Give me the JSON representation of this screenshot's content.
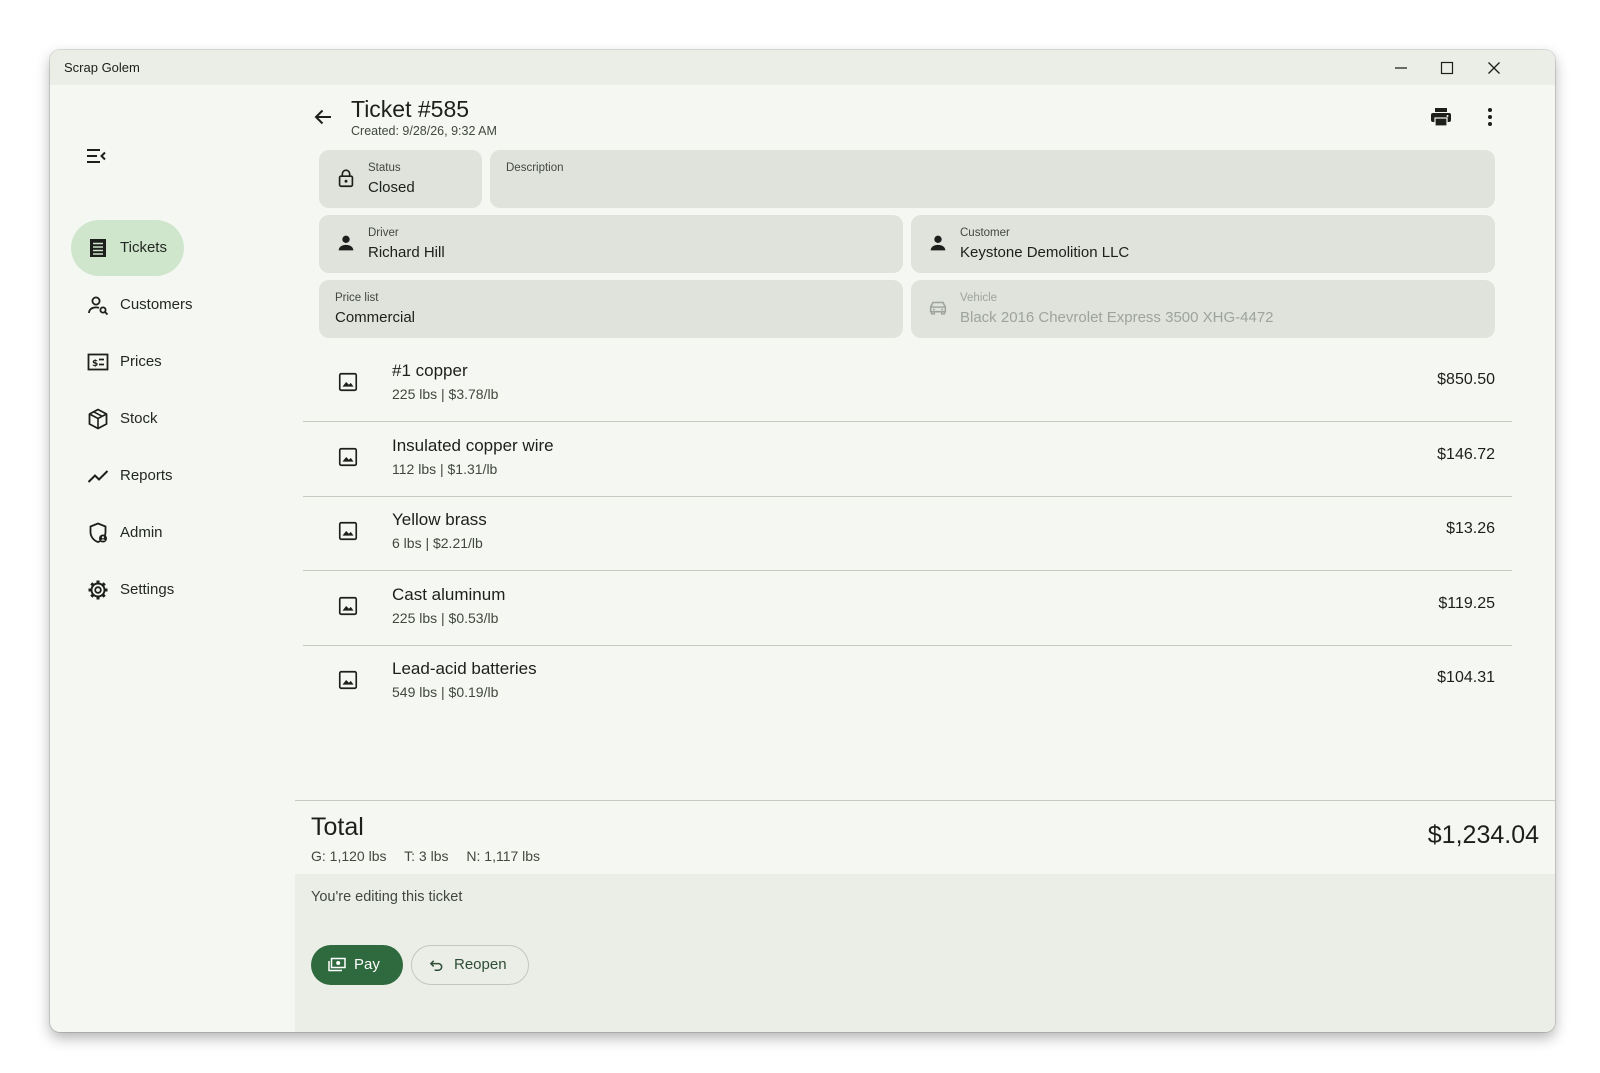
{
  "window": {
    "title": "Scrap Golem"
  },
  "sidebar": {
    "items": [
      {
        "label": "Tickets",
        "icon": "receipt-icon",
        "active": true
      },
      {
        "label": "Customers",
        "icon": "person-search-icon"
      },
      {
        "label": "Prices",
        "icon": "price-card-icon"
      },
      {
        "label": "Stock",
        "icon": "package-icon"
      },
      {
        "label": "Reports",
        "icon": "trending-line-icon"
      },
      {
        "label": "Admin",
        "icon": "admin-shield-icon"
      },
      {
        "label": "Settings",
        "icon": "gear-icon"
      }
    ]
  },
  "header": {
    "title": "Ticket #585",
    "created": "Created: 9/28/26, 9:32 AM"
  },
  "fields": {
    "status": {
      "label": "Status",
      "value": "Closed"
    },
    "description": {
      "label": "Description",
      "value": ""
    },
    "driver": {
      "label": "Driver",
      "value": "Richard Hill"
    },
    "customer": {
      "label": "Customer",
      "value": "Keystone Demolition LLC"
    },
    "price_list": {
      "label": "Price list",
      "value": "Commercial"
    },
    "vehicle": {
      "label": "Vehicle",
      "value": "Black 2016 Chevrolet Express 3500 XHG-4472"
    }
  },
  "items": [
    {
      "name": "#1 copper",
      "detail": "225 lbs | $3.78/lb",
      "price": "$850.50"
    },
    {
      "name": "Insulated copper wire",
      "detail": "112 lbs | $1.31/lb",
      "price": "$146.72"
    },
    {
      "name": "Yellow brass",
      "detail": "6 lbs | $2.21/lb",
      "price": "$13.26"
    },
    {
      "name": "Cast aluminum",
      "detail": "225 lbs | $0.53/lb",
      "price": "$119.25"
    },
    {
      "name": "Lead-acid batteries",
      "detail": "549 lbs | $0.19/lb",
      "price": "$104.31"
    }
  ],
  "total": {
    "label": "Total",
    "gross": "G: 1,120 lbs",
    "tare": "T: 3 lbs",
    "net": "N: 1,117 lbs",
    "amount": "$1,234.04"
  },
  "footer": {
    "note": "You're editing this ticket",
    "pay_label": "Pay",
    "reopen_label": "Reopen"
  },
  "colors": {
    "accent": "#2e6a3d",
    "nav_active": "#cfe6cd",
    "field_bg": "#dfe3dc",
    "window_bg": "#f5f8f2"
  }
}
